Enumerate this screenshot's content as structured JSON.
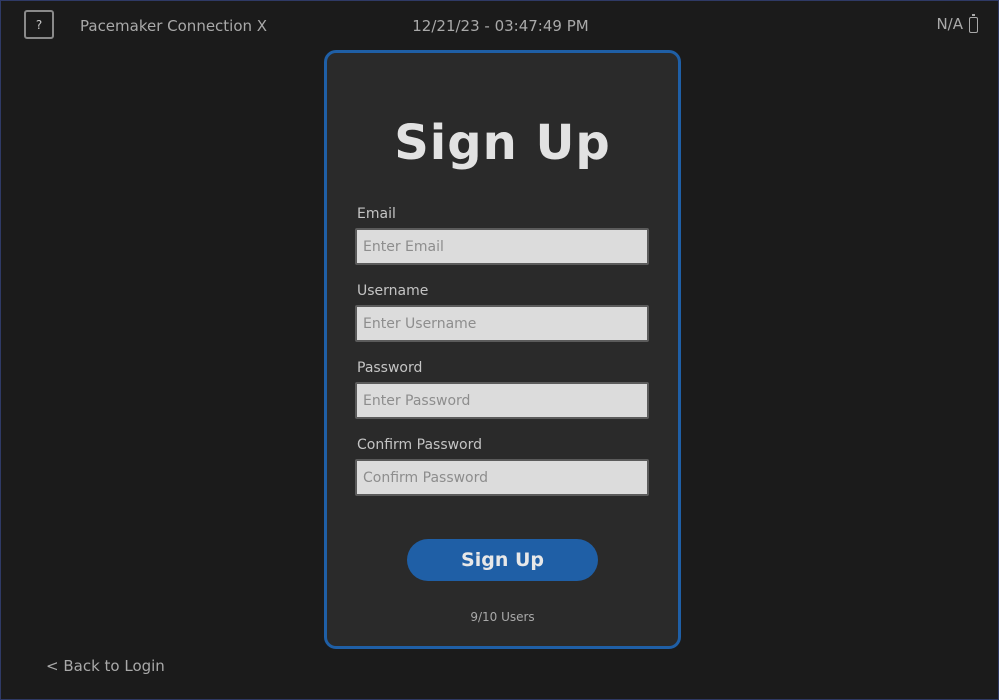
{
  "header": {
    "help_label": "?",
    "app_title": "Pacemaker Connection X",
    "datetime": "12/21/23 - 03:47:49 PM",
    "connection_status": "N/A",
    "battery_icon": "battery-icon"
  },
  "signup": {
    "title": "Sign Up",
    "fields": [
      {
        "label": "Email",
        "placeholder": "Enter Email",
        "value": ""
      },
      {
        "label": "Username",
        "placeholder": "Enter Username",
        "value": ""
      },
      {
        "label": "Password",
        "placeholder": "Enter Password",
        "value": ""
      },
      {
        "label": "Confirm Password",
        "placeholder": "Confirm Password",
        "value": ""
      }
    ],
    "button_label": "Sign Up",
    "user_count": "9/10 Users"
  },
  "footer": {
    "back_label": "< Back to Login"
  },
  "colors": {
    "background": "#1b1b1b",
    "card": "#2a2a2a",
    "accent": "#1f5fa6",
    "input": "#dcdcdc",
    "text_muted": "#a9a9a9"
  }
}
